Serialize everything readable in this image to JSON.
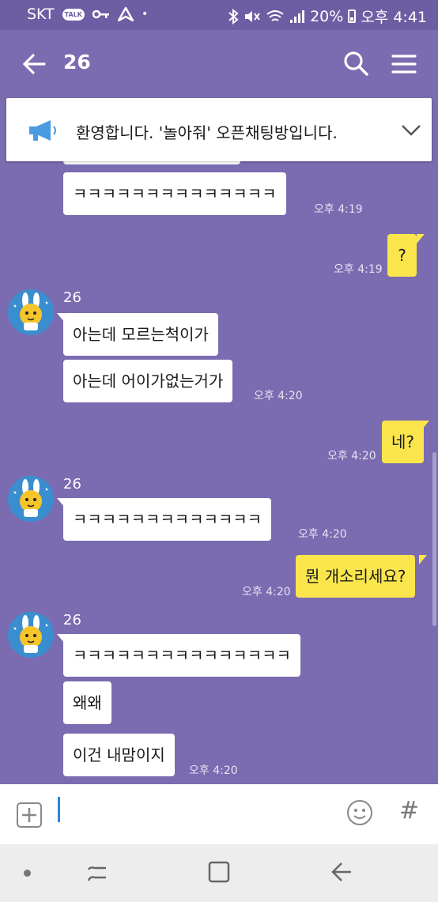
{
  "status_bar": {
    "carrier": "SKT",
    "talk_badge": "TALK",
    "battery": "20%",
    "time": "오후 4:41"
  },
  "header": {
    "title": "26"
  },
  "notice": {
    "text": "환영합니다. '놀아줘' 오픈채팅방입니다."
  },
  "messages": [
    {
      "side": "left",
      "text": "ㅋㅋㅋㅋㅋㅋㅋㅋㅋㅋㅋㅋㅋㅋ",
      "time": "오후 4:19"
    },
    {
      "side": "right",
      "text": "?",
      "time": "오후 4:19"
    },
    {
      "side": "left",
      "sender": "26",
      "text": "아는데 모르는척이가"
    },
    {
      "side": "left",
      "text": "아는데 어이가없는거가",
      "time": "오후 4:20"
    },
    {
      "side": "right",
      "text": "네?",
      "time": "오후 4:20"
    },
    {
      "side": "left",
      "sender": "26",
      "text": "ㅋㅋㅋㅋㅋㅋㅋㅋㅋㅋㅋㅋㅋ",
      "time": "오후 4:20"
    },
    {
      "side": "right",
      "text": "뭔 개소리세요?",
      "time": "오후 4:20"
    },
    {
      "side": "left",
      "sender": "26",
      "text": "ㅋㅋㅋㅋㅋㅋㅋㅋㅋㅋㅋㅋㅋㅋㅋ"
    },
    {
      "side": "left",
      "text": "왜왜"
    },
    {
      "side": "left",
      "text": "이건 내맘이지",
      "time": "오후 4:20"
    }
  ],
  "colors": {
    "background": "#7b6bb0",
    "my_bubble": "#fae64c",
    "other_bubble": "#ffffff",
    "cursor": "#2a84d8"
  },
  "icons": {
    "back": "back-arrow-icon",
    "search": "search-icon",
    "menu": "hamburger-menu-icon",
    "notice": "megaphone-icon",
    "expand": "chevron-down-icon",
    "attach": "plus-box-icon",
    "emoji": "emoticon-icon",
    "hashtag": "#"
  }
}
